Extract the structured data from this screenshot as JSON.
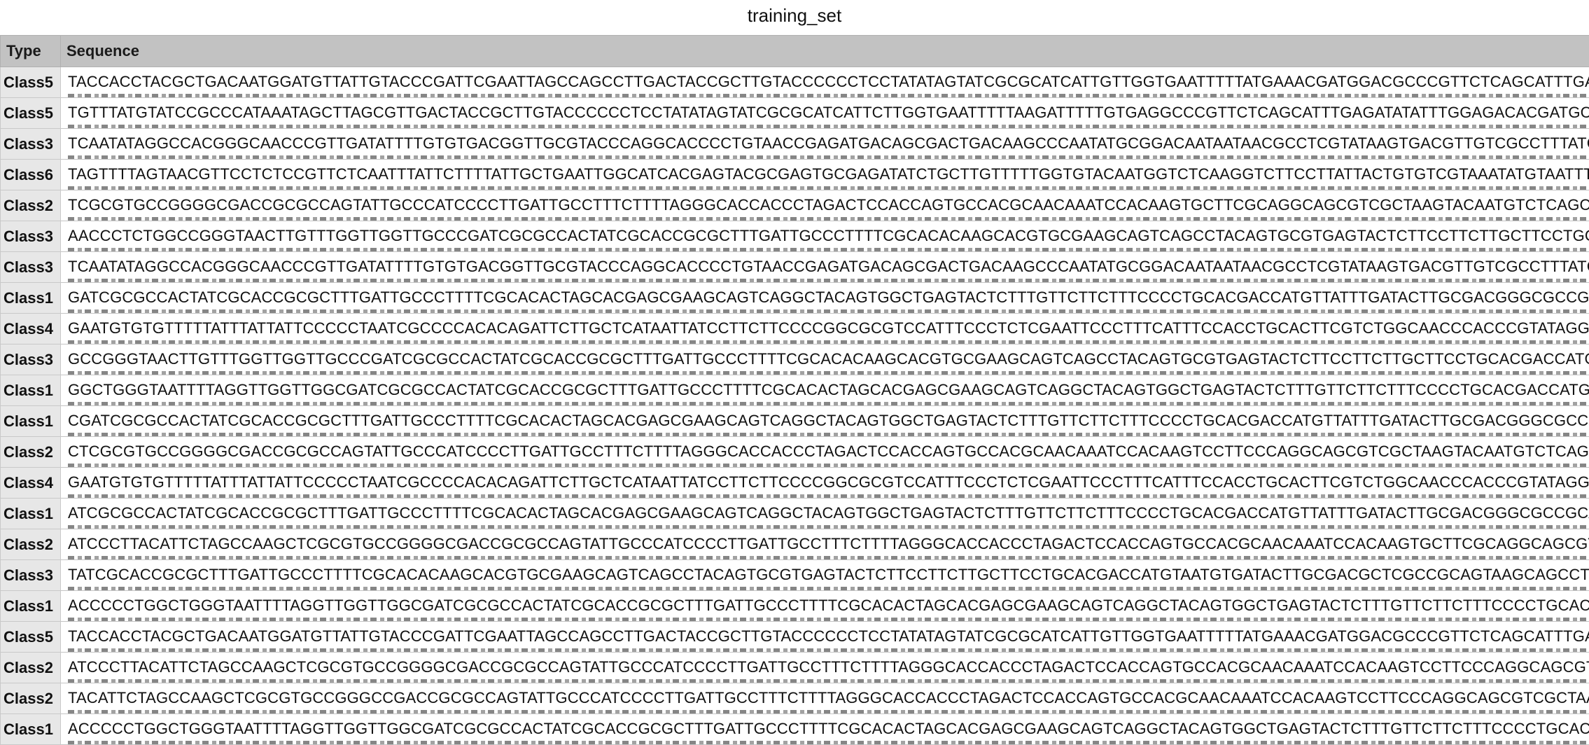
{
  "window": {
    "title": "training_set"
  },
  "table": {
    "columns": [
      "Type",
      "Sequence"
    ],
    "rows": [
      {
        "type": "Class5",
        "sequence": "TACCACCTACGCTGACAATGGATGTTATTGTACCCGATTCGAATTAGCCAGCCTTGACTACCGCTTGTACCCCCCTCCTATATAGTATCGCGCATCATTGTTGGTGAATTTTTATGAAACGATGGACGCCCGTTCTCAGCATTTGAGAGATAT"
      },
      {
        "type": "Class5",
        "sequence": "TGTTTATGTATCCGCCCATAAATAGCTTAGCGTTGACTACCGCTTGTACCCCCCTCCTATATAGTATCGCGCATCATTCTTGGTGAATTTTTAAGATTTTTGTGAGGCCCGTTCTCAGCATTTGAGATATATTTGGAGACACGATGCACAGTT"
      },
      {
        "type": "Class3",
        "sequence": "TCAATATAGGCCACGGGCAACCCGTTGATATTTTGTGTGACGGTTGCGTACCCAGGCACCCCTGTAACCGAGATGACAGCGACTGACAAGCCCAATATGCGGACAATAATAACGCCTCGTATAAGTGACGTTGTCGCCTTTATCAAGTGC"
      },
      {
        "type": "Class6",
        "sequence": "TAGTTTTAGTAACGTTCCTCTCCGTTCTCAATTTATTCTTTTATTGCTGAATTGGCATCACGAGTACGCGAGTGCGAGATATCTGCTTGTTTTTGGTGTACAATGGTCTCAAGGTCTTCCTTATTACTGTGTCGTAAATATGTAATTTTATTGGGAC"
      },
      {
        "type": "Class2",
        "sequence": "TCGCGTGCCGGGGCGACCGCGCCAGTATTGCCCATCCCCTTGATTGCCTTTCTTTTAGGGCACCACCCTAGACTCCACCAGTGCCACGCAACAAATCCACAAGTGCTTCGCAGGCAGCGTCGCTAAGTACAATGTCTCAGCGTTGTG"
      },
      {
        "type": "Class3",
        "sequence": "AACCCTCTGGCCGGGTAACTTGTTTGGTTGGTTGCCCGATCGCGCCACTATCGCACCGCGCTTTGATTGCCCTTTTCGCACACAAGCACGTGCGAAGCAGTCAGCCTACAGTGCGTGAGTACTCTTCCTTCTTGCTTCCTGCACGACC"
      },
      {
        "type": "Class3",
        "sequence": "TCAATATAGGCCACGGGCAACCCGTTGATATTTTGTGTGACGGTTGCGTACCCAGGCACCCCTGTAACCGAGATGACAGCGACTGACAAGCCCAATATGCGGACAATAATAACGCCTCGTATAAGTGACGTTGTCGCCTTTATCAAGTGC"
      },
      {
        "type": "Class1",
        "sequence": "GATCGCGCCACTATCGCACCGCGCTTTGATTGCCCTTTTCGCACACTAGCACGAGCGAAGCAGTCAGGCTACAGTGGCTGAGTACTCTTTGTTCTTCTTTCCCCTGCACGACCATGTTATTTGATACTTGCGACGGGCGCCGCAGTATG"
      },
      {
        "type": "Class4",
        "sequence": "GAATGTGTGTTTTTATTTATTATTCCCCCTAATCGCCCCACACAGATTCTTGCTCATAATTATCCTTCTTCCCCGGCGCGTCCATTTCCCTCTCGAATTCCCTTTCATTTCCACCTGCACTTCGTCTGGCAACCCACCCGTATAGGTCTCGT"
      },
      {
        "type": "Class3",
        "sequence": "GCCGGGTAACTTGTTTGGTTGGTTGCCCGATCGCGCCACTATCGCACCGCGCTTTGATTGCCCTTTTCGCACACAAGCACGTGCGAAGCAGTCAGCCTACAGTGCGTGAGTACTCTTCCTTCTTGCTTCCTGCACGACCATGTAATGTC"
      },
      {
        "type": "Class1",
        "sequence": "GGCTGGGTAATTTTAGGTTGGTTGGCGATCGCGCCACTATCGCACCGCGCTTTGATTGCCCTTTTCGCACACTAGCACGAGCGAAGCAGTCAGGCTACAGTGGCTGAGTACTCTTTGTTCTTCTTTCCCCTGCACGACCATGTTATTTGA"
      },
      {
        "type": "Class1",
        "sequence": "CGATCGCGCCACTATCGCACCGCGCTTTGATTGCCCTTTTCGCACACTAGCACGAGCGAAGCAGTCAGGCTACAGTGGCTGAGTACTCTTTGTTCTTCTTTCCCCTGCACGACCATGTTATTTGATACTTGCGACGGGCGCCGCAGTAT"
      },
      {
        "type": "Class2",
        "sequence": "CTCGCGTGCCGGGGCGACCGCGCCAGTATTGCCCATCCCCTTGATTGCCTTTCTTTTAGGGCACCACCCTAGACTCCACCAGTGCCACGCAACAAATCCACAAGTCCTTCCCAGGCAGCGTCGCTAAGTACAATGTCTCAGCGTTGT"
      },
      {
        "type": "Class4",
        "sequence": "GAATGTGTGTTTTTATTTATTATTCCCCCTAATCGCCCCACACAGATTCTTGCTCATAATTATCCTTCTTCCCCGGCGCGTCCATTTCCCTCTCGAATTCCCTTTCATTTCCACCTGCACTTCGTCTGGCAACCCACCCGTATAGGTCTCGT"
      },
      {
        "type": "Class1",
        "sequence": "ATCGCGCCACTATCGCACCGCGCTTTGATTGCCCTTTTCGCACACTAGCACGAGCGAAGCAGTCAGGCTACAGTGGCTGAGTACTCTTTGTTCTTCTTTCCCCTGCACGACCATGTTATTTGATACTTGCGACGGGCGCCGCAGTATGC"
      },
      {
        "type": "Class2",
        "sequence": "ATCCCTTACATTCTAGCCAAGCTCGCGTGCCGGGGCGACCGCGCCAGTATTGCCCATCCCCTTGATTGCCTTTCTTTTAGGGCACCACCCTAGACTCCACCAGTGCCACGCAACAAATCCACAAGTGCTTCGCAGGCAGCGTCGCTAAC"
      },
      {
        "type": "Class3",
        "sequence": "TATCGCACCGCGCTTTGATTGCCCTTTTCGCACACAAGCACGTGCGAAGCAGTCAGCCTACAGTGCGTGAGTACTCTTCCTTCTTGCTTCCTGCACGACCATGTAATGTGATACTTGCGACGCTCGCCGCAGTAAGCAGCCTGAACCC"
      },
      {
        "type": "Class1",
        "sequence": "ACCCCCTGGCTGGGTAATTTTAGGTTGGTTGGCGATCGCGCCACTATCGCACCGCGCTTTGATTGCCCTTTTCGCACACTAGCACGAGCGAAGCAGTCAGGCTACAGTGGCTGAGTACTCTTTGTTCTTCTTTCCCCTGCACGACCATG"
      },
      {
        "type": "Class5",
        "sequence": "TACCACCTACGCTGACAATGGATGTTATTGTACCCGATTCGAATTAGCCAGCCTTGACTACCGCTTGTACCCCCCTCCTATATAGTATCGCGCATCATTGTTGGTGAATTTTTATGAAACGATGGACGCCCGTTCTCAGCATTTGAGAGATAT"
      },
      {
        "type": "Class2",
        "sequence": "ATCCCTTACATTCTAGCCAAGCTCGCGTGCCGGGGCGACCGCGCCAGTATTGCCCATCCCCTTGATTGCCTTTCTTTTAGGGCACCACCCTAGACTCCACCAGTGCCACGCAACAAATCCACAAGTCCTTCCCAGGCAGCGTCGCTAA"
      },
      {
        "type": "Class2",
        "sequence": "TACATTCTAGCCAAGCTCGCGTGCCGGGCCGACCGCGCCAGTATTGCCCATCCCCTTGATTGCCTTTCTTTTAGGGCACCACCCTAGACTCCACCAGTGCCACGCAACAAATCCACAAGTCCTTCCCAGGCAGCGTCGCTAAGTACAA"
      },
      {
        "type": "Class1",
        "sequence": "ACCCCCTGGCTGGGTAATTTTAGGTTGGTTGGCGATCGCGCCACTATCGCACCGCGCTTTGATTGCCCTTTTCGCACACTAGCACGAGCGAAGCAGTCAGGCTACAGTGGCTGAGTACTCTTTGTTCTTCTTTCCCCTGCACGACCATG"
      }
    ]
  }
}
